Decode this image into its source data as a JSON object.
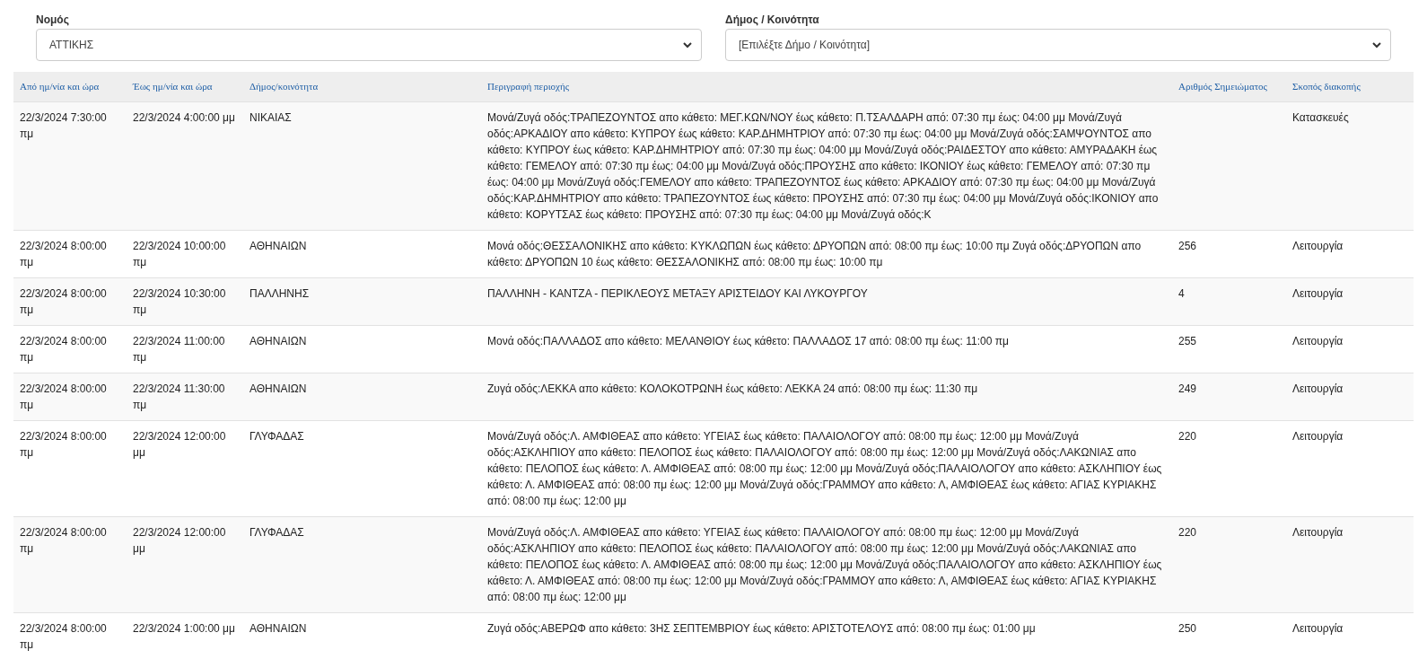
{
  "filters": [
    {
      "label": "Νομός",
      "value": "ΑΤΤΙΚΗΣ"
    },
    {
      "label": "Δήμος / Κοινότητα",
      "value": "[Επιλέξτε Δήμο / Κοινότητα]"
    }
  ],
  "table": {
    "columns": [
      "Από ημ/νία και ώρα",
      "Έως ημ/νία και ώρα",
      "Δήμος/κοινότητα",
      "Περιγραφή περιοχής",
      "Αριθμός Σημειώματος",
      "Σκοπός διακοπής"
    ],
    "rows": [
      [
        "22/3/2024 7:30:00 πμ",
        "22/3/2024 4:00:00 μμ",
        "ΝΙΚΑΙΑΣ",
        "Μονά/Ζυγά οδός:ΤΡΑΠΕΖΟΥΝΤΟΣ απο κάθετο: ΜΕΓ.ΚΩΝ/ΝΟΥ έως κάθετο: Π.ΤΣΑΛΔΑΡΗ από: 07:30 πμ έως: 04:00 μμ Μονά/Ζυγά οδός:ΑΡΚΑΔΙΟΥ απο κάθετο: ΚΥΠΡΟΥ έως κάθετο: ΚΑΡ.ΔΗΜΗΤΡΙΟΥ από: 07:30 πμ έως: 04:00 μμ Μονά/Ζυγά οδός:ΣΑΜΨΟΥΝΤΟΣ απο κάθετο: ΚΥΠΡΟΥ έως κάθετο: ΚΑΡ.ΔΗΜΗΤΡΙΟΥ από: 07:30 πμ έως: 04:00 μμ Μονά/Ζυγά οδός:ΡΑΙΔΕΣΤΟΥ απο κάθετο: ΑΜΥΡΑΔΑΚΗ έως κάθετο: ΓΕΜΕΛΟΥ από: 07:30 πμ έως: 04:00 μμ Μονά/Ζυγά οδός:ΠΡΟΥΣΗΣ απο κάθετο: ΙΚΟΝΙΟΥ έως κάθετο: ΓΕΜΕΛΟΥ από: 07:30 πμ έως: 04:00 μμ Μονά/Ζυγά οδός:ΓΕΜΕΛΟΥ απο κάθετο: ΤΡΑΠΕΖΟΥΝΤΟΣ έως κάθετο: ΑΡΚΑΔΙΟΥ από: 07:30 πμ έως: 04:00 μμ Μονά/Ζυγά οδός:ΚΑΡ.ΔΗΜΗΤΡΙΟΥ απο κάθετο: ΤΡΑΠΕΖΟΥΝΤΟΣ έως κάθετο: ΠΡΟΥΣΗΣ από: 07:30 πμ έως: 04:00 μμ Μονά/Ζυγά οδός:ΙΚΟΝΙΟΥ απο κάθετο: ΚΟΡΥΤΣΑΣ έως κάθετο: ΠΡΟΥΣΗΣ από: 07:30 πμ έως: 04:00 μμ Μονά/Ζυγά οδός:Κ",
        "",
        "Κατασκευές"
      ],
      [
        "22/3/2024 8:00:00 πμ",
        "22/3/2024 10:00:00 πμ",
        "ΑΘΗΝΑΙΩΝ",
        "Μονά οδός:ΘΕΣΣΑΛΟΝΙΚΗΣ απο κάθετο: ΚΥΚΛΩΠΩΝ έως κάθετο: ΔΡΥΟΠΩΝ από: 08:00 πμ έως: 10:00 πμ Ζυγά οδός:ΔΡΥΟΠΩΝ απο κάθετο: ΔΡΥΟΠΩΝ 10 έως κάθετο: ΘΕΣΣΑΛΟΝΙΚΗΣ από: 08:00 πμ έως: 10:00 πμ",
        "256",
        "Λειτουργία"
      ],
      [
        "22/3/2024 8:00:00 πμ",
        "22/3/2024 10:30:00 πμ",
        "ΠΑΛΛΗΝΗΣ",
        "ΠΑΛΛΗΝΗ - ΚΑΝΤΖΑ - ΠΕΡΙΚΛΕΟΥΣ ΜΕΤΑΞΥ ΑΡΙΣΤΕΙΔΟΥ ΚΑΙ ΛΥΚΟΥΡΓΟΥ",
        "4",
        "Λειτουργία"
      ],
      [
        "22/3/2024 8:00:00 πμ",
        "22/3/2024 11:00:00 πμ",
        "ΑΘΗΝΑΙΩΝ",
        "Μονά οδός:ΠΑΛΛΑΔΟΣ απο κάθετο: ΜΕΛΑΝΘΙΟΥ έως κάθετο: ΠΑΛΛΑΔΟΣ 17 από: 08:00 πμ έως: 11:00 πμ",
        "255",
        "Λειτουργία"
      ],
      [
        "22/3/2024 8:00:00 πμ",
        "22/3/2024 11:30:00 πμ",
        "ΑΘΗΝΑΙΩΝ",
        "Ζυγά οδός:ΛΕΚΚΑ απο κάθετο: ΚΟΛΟΚΟΤΡΩΝΗ έως κάθετο: ΛΕΚΚΑ 24 από: 08:00 πμ έως: 11:30 πμ",
        "249",
        "Λειτουργία"
      ],
      [
        "22/3/2024 8:00:00 πμ",
        "22/3/2024 12:00:00 μμ",
        "ΓΛΥΦΑΔΑΣ",
        "Μονά/Ζυγά οδός:Λ. ΑΜΦΙΘΕΑΣ απο κάθετο: ΥΓΕΙΑΣ έως κάθετο: ΠΑΛΑΙΟΛΟΓΟΥ από: 08:00 πμ έως: 12:00 μμ Μονά/Ζυγά οδός:ΑΣΚΛΗΠΙΟΥ απο κάθετο: ΠΕΛΟΠΟΣ έως κάθετο: ΠΑΛΑΙΟΛΟΓΟΥ από: 08:00 πμ έως: 12:00 μμ Μονά/Ζυγά οδός:ΛΑΚΩΝΙΑΣ απο κάθετο: ΠΕΛΟΠΟΣ έως κάθετο: Λ. ΑΜΦΙΘΕΑΣ από: 08:00 πμ έως: 12:00 μμ Μονά/Ζυγά οδός:ΠΑΛΑΙΟΛΟΓΟΥ απο κάθετο: ΑΣΚΛΗΠΙΟΥ έως κάθετο: Λ. ΑΜΦΙΘΕΑΣ από: 08:00 πμ έως: 12:00 μμ Μονά/Ζυγά οδός:ΓΡΑΜΜΟΥ απο κάθετο: Λ, ΑΜΦΙΘΕΑΣ έως κάθετο: ΑΓΙΑΣ ΚΥΡΙΑΚΗΣ από: 08:00 πμ έως: 12:00 μμ",
        "220",
        "Λειτουργία"
      ],
      [
        "22/3/2024 8:00:00 πμ",
        "22/3/2024 12:00:00 μμ",
        "ΓΛΥΦΑΔΑΣ",
        "Μονά/Ζυγά οδός:Λ. ΑΜΦΙΘΕΑΣ απο κάθετο: ΥΓΕΙΑΣ έως κάθετο: ΠΑΛΑΙΟΛΟΓΟΥ από: 08:00 πμ έως: 12:00 μμ Μονά/Ζυγά οδός:ΑΣΚΛΗΠΙΟΥ απο κάθετο: ΠΕΛΟΠΟΣ έως κάθετο: ΠΑΛΑΙΟΛΟΓΟΥ από: 08:00 πμ έως: 12:00 μμ Μονά/Ζυγά οδός:ΛΑΚΩΝΙΑΣ απο κάθετο: ΠΕΛΟΠΟΣ έως κάθετο: Λ. ΑΜΦΙΘΕΑΣ από: 08:00 πμ έως: 12:00 μμ Μονά/Ζυγά οδός:ΠΑΛΑΙΟΛΟΓΟΥ απο κάθετο: ΑΣΚΛΗΠΙΟΥ έως κάθετο: Λ. ΑΜΦΙΘΕΑΣ από: 08:00 πμ έως: 12:00 μμ Μονά/Ζυγά οδός:ΓΡΑΜΜΟΥ απο κάθετο: Λ, ΑΜΦΙΘΕΑΣ έως κάθετο: ΑΓΙΑΣ ΚΥΡΙΑΚΗΣ από: 08:00 πμ έως: 12:00 μμ",
        "220",
        "Λειτουργία"
      ],
      [
        "22/3/2024 8:00:00 πμ",
        "22/3/2024 1:00:00 μμ",
        "ΑΘΗΝΑΙΩΝ",
        "Ζυγά οδός:ΑΒΕΡΩΦ απο κάθετο: 3ΗΣ ΣΕΠΤΕΜΒΡΙΟΥ έως κάθετο: ΑΡΙΣΤΟΤΕΛΟΥΣ από: 08:00 πμ έως: 01:00 μμ",
        "250",
        "Λειτουργία"
      ]
    ]
  }
}
